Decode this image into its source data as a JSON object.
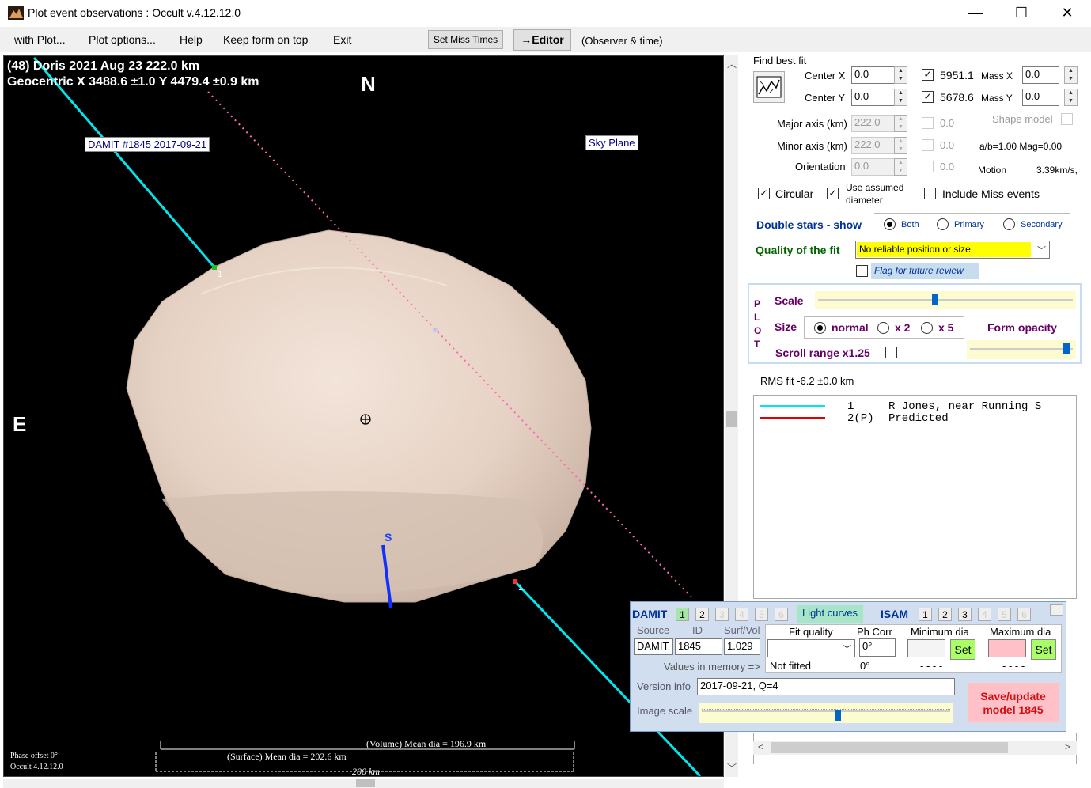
{
  "window": {
    "title": "Plot event observations : Occult v.4.12.12.0",
    "minimize_glyph": "—",
    "maximize_glyph": "☐",
    "close_glyph": "✕"
  },
  "menu": {
    "items": [
      "with Plot...",
      "Plot options...",
      "Help",
      "Keep form on top",
      "Exit"
    ],
    "set_miss_times": "Set Miss Times",
    "editor": "→Editor",
    "observer_time": "(Observer & time)"
  },
  "plot": {
    "header_line1": "(48) Doris  2021 Aug 23   222.0 km",
    "header_line2": "Geocentric  X  3488.6 ±1.0  Y 4479.4 ±0.9 km",
    "north": "N",
    "east": "E",
    "south_marker": "S",
    "damit_label": "DAMIT #1845 2017-09-21",
    "sky_plane": "Sky Plane",
    "chord_label_1": "1",
    "chord_label_2": "1",
    "volume_mean": "(Volume) Mean dia = 196.9 km",
    "surface_mean": "(Surface) Mean dia = 202.6 km",
    "scale_bar": "200 km",
    "phase_offset": "Phase offset 0°",
    "version": "Occult 4.12.12.0"
  },
  "fit": {
    "find_best_fit": "Find best fit",
    "center_x_label": "Center X",
    "center_x": "0.0",
    "center_y_label": "Center Y",
    "center_y": "0.0",
    "cx_value": "5951.1",
    "cy_value": "5678.6",
    "mass_x_label": "Mass X",
    "mass_x": "0.0",
    "mass_y_label": "Mass Y",
    "mass_y": "0.0",
    "major_label": "Major axis (km)",
    "major": "222.0",
    "minor_label": "Minor axis (km)",
    "minor": "222.0",
    "orient_label": "Orientation",
    "orient": "0.0",
    "major_chk_val": "0.0",
    "minor_chk_val": "0.0",
    "orient_chk_val": "0.0",
    "shape_model": "Shape model",
    "ab_ratio": "a/b=1.00  Mag=0.00",
    "motion_label": "Motion",
    "motion": "3.39km/s,",
    "circular": "Circular",
    "use_assumed_1": "Use assumed",
    "use_assumed_2": "diameter",
    "include_miss": "Include Miss events",
    "double_stars": "Double stars - show",
    "both": "Both",
    "primary": "Primary",
    "secondary": "Secondary",
    "quality_label": "Quality of the fit",
    "quality_value": "No reliable position or size",
    "flag_review": "Flag for future review"
  },
  "plotpanel": {
    "plot_letters": [
      "P",
      "L",
      "O",
      "T"
    ],
    "scale": "Scale",
    "size": "Size",
    "normal": "normal",
    "x2": "x 2",
    "x5": "x 5",
    "form_opacity": "Form opacity",
    "scroll_range": "Scroll range x1.25",
    "scale_value": 0.46,
    "opacity_value": 0.97
  },
  "rms": {
    "label": "RMS fit -6.2 ±0.0 km",
    "rows": [
      {
        "num": "1",
        "name": "R Jones, near Running S",
        "color": "#00e5ee"
      },
      {
        "num": "2(P)",
        "name": "Predicted",
        "color": "#e00000"
      }
    ]
  },
  "damit": {
    "damit_title": "DAMIT",
    "damit_nums": [
      "1",
      "2",
      "3",
      "4",
      "5",
      "6"
    ],
    "light_curves": "Light curves",
    "isam_title": "ISAM",
    "isam_nums": [
      "1",
      "2",
      "3",
      "4",
      "5",
      "6"
    ],
    "source_label": "Source",
    "id_label": "ID",
    "surfvol_label": "Surf/Vol",
    "fit_quality_label": "Fit quality",
    "ph_corr_label": "Ph Corr",
    "min_dia_label": "Minimum dia",
    "max_dia_label": "Maximum dia",
    "source": "DAMIT",
    "id": "1845",
    "surfvol": "1.029",
    "ph_corr": "0°",
    "values_in_memory": "Values in memory =>",
    "not_fitted": "Not fitted",
    "ph_mem": "0°",
    "min_dash": "- - - -",
    "max_dash": "- - - -",
    "set": "Set",
    "version_label": "Version info",
    "version": "2017-09-21, Q=4",
    "image_scale_label": "Image scale",
    "image_scale": 0.55,
    "save_btn_1": "Save/update",
    "save_btn_2": "model 1845"
  },
  "colors": {
    "chord": "#00e5ee",
    "predicted": "#ff69b4",
    "asteroid": "#e8d5c8",
    "south_line": "#1030ff",
    "quality_bg": "#ffff00",
    "save_bg": "#ffc0c8",
    "set_bg": "#aaff66"
  }
}
